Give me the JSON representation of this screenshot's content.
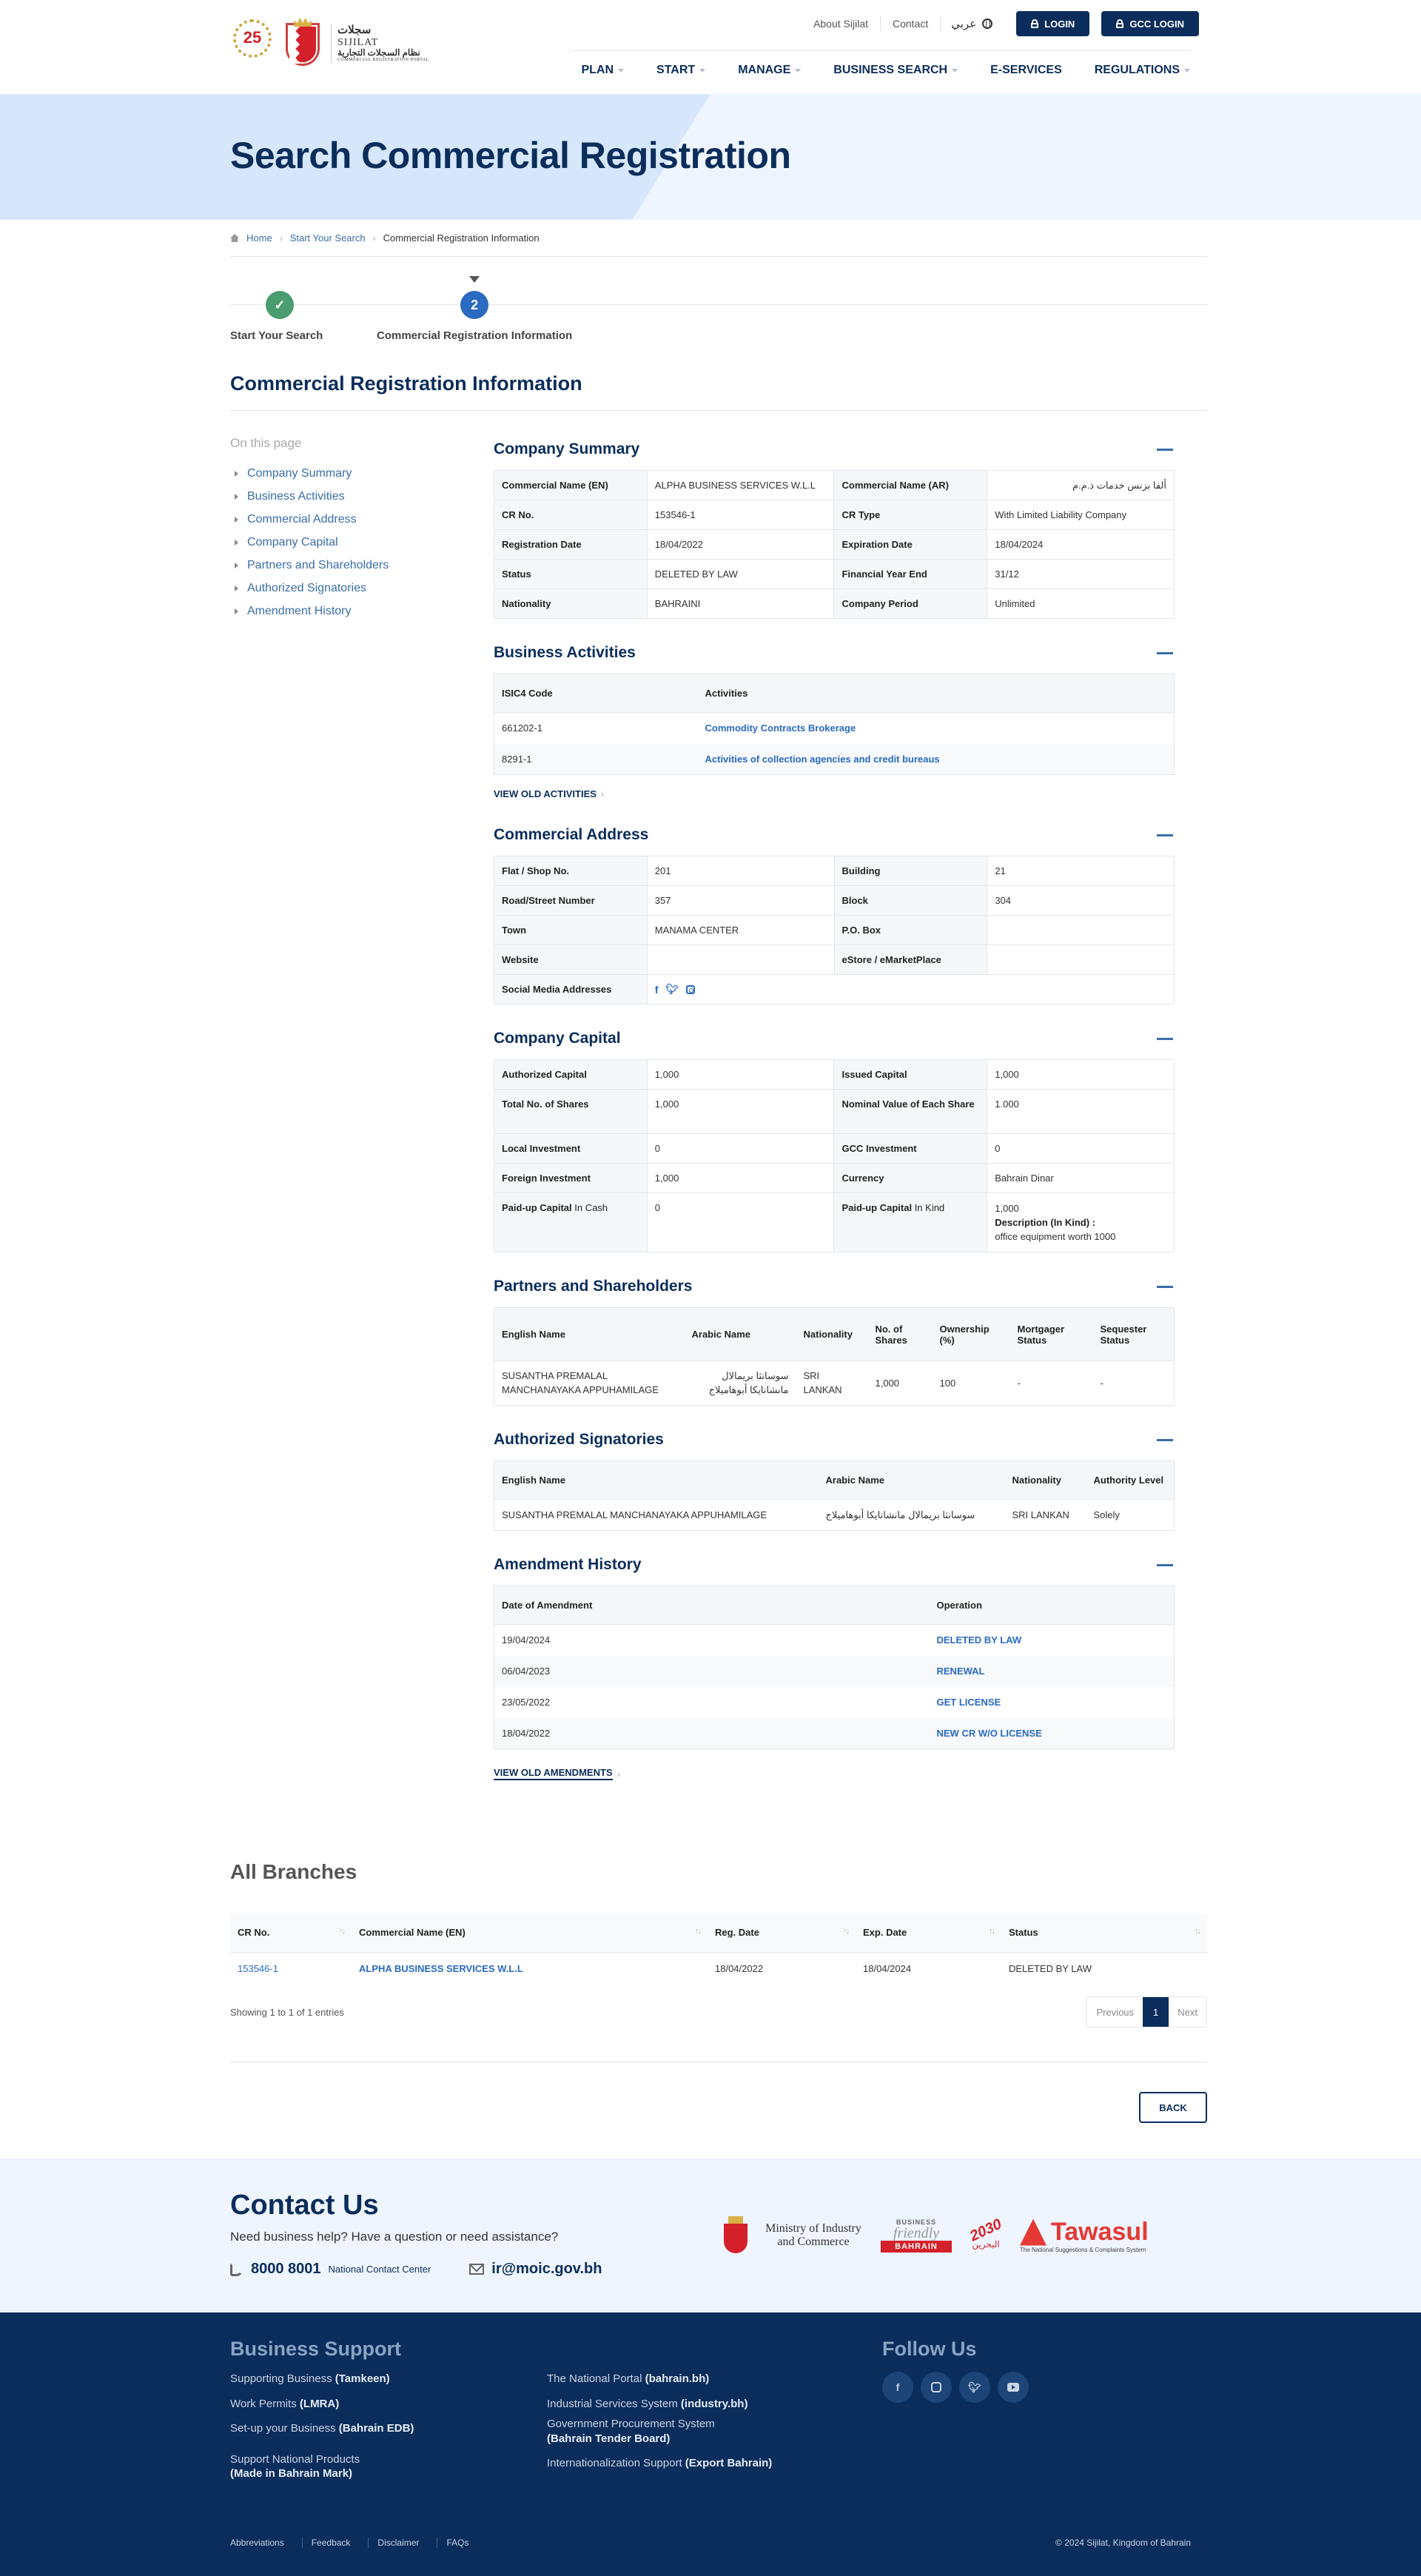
{
  "header": {
    "logo": {
      "badge": "25",
      "arabic": "سجلات",
      "english": "SIJILAT",
      "arabic_sub": "نظام السجلات التجارية",
      "portal": "COMMERCIAL REGISTRATION PORTAL"
    },
    "top_links": [
      "About Sijilat",
      "Contact"
    ],
    "language": "عربي",
    "login_label": "LOGIN",
    "gcc_login_label": "GCC LOGIN",
    "nav": [
      {
        "label": "PLAN",
        "dropdown": true
      },
      {
        "label": "START",
        "dropdown": true
      },
      {
        "label": "MANAGE",
        "dropdown": true
      },
      {
        "label": "BUSINESS SEARCH",
        "dropdown": true
      },
      {
        "label": "E-SERVICES",
        "dropdown": false
      },
      {
        "label": "REGULATIONS",
        "dropdown": true
      }
    ]
  },
  "hero": {
    "title": "Search Commercial Registration"
  },
  "breadcrumb": {
    "home": "Home",
    "step": "Start Your Search",
    "current": "Commercial Registration Information"
  },
  "stepper": {
    "steps": [
      {
        "label": "Start Your Search",
        "marker": "✓",
        "state": "done"
      },
      {
        "label": "Commercial Registration Information",
        "marker": "2",
        "state": "current"
      }
    ]
  },
  "page_title": "Commercial Registration Information",
  "sidenav": {
    "heading": "On this page",
    "items": [
      "Company Summary",
      "Business Activities",
      "Commercial Address",
      "Company Capital",
      "Partners and Shareholders",
      "Authorized Signatories",
      "Amendment History"
    ]
  },
  "summary": {
    "title": "Company Summary",
    "rows": [
      {
        "k1": "Commercial Name (EN)",
        "v1": "ALPHA BUSINESS SERVICES W.L.L",
        "k2": "Commercial Name (AR)",
        "v2": "ألفا بزنس خدمات ذ.م.م"
      },
      {
        "k1": "CR No.",
        "v1": "153546-1",
        "k2": "CR Type",
        "v2": "With Limited Liability Company"
      },
      {
        "k1": "Registration Date",
        "v1": "18/04/2022",
        "k2": "Expiration Date",
        "v2": "18/04/2024"
      },
      {
        "k1": "Status",
        "v1": "DELETED BY LAW",
        "k2": "Financial Year End",
        "v2": "31/12"
      },
      {
        "k1": "Nationality",
        "v1": "BAHRAINI",
        "k2": "Company Period",
        "v2": "Unlimited"
      }
    ],
    "status_color": "#d4202a"
  },
  "activities": {
    "title": "Business Activities",
    "headers": [
      "ISIC4 Code",
      "Activities"
    ],
    "rows": [
      {
        "code": "661202-1",
        "activity": "Commodity Contracts Brokerage"
      },
      {
        "code": "8291-1",
        "activity": "Activities of collection agencies and credit bureaus"
      }
    ],
    "more": "VIEW OLD ACTIVITIES"
  },
  "address": {
    "title": "Commercial Address",
    "rows": [
      {
        "k1": "Flat / Shop No.",
        "v1": "201",
        "k2": "Building",
        "v2": "21"
      },
      {
        "k1": "Road/Street Number",
        "v1": "357",
        "k2": "Block",
        "v2": "304"
      },
      {
        "k1": "Town",
        "v1": "MANAMA CENTER",
        "k2": "P.O. Box",
        "v2": ""
      },
      {
        "k1": "Website",
        "v1": "",
        "k2": "eStore / eMarketPlace",
        "v2": ""
      }
    ],
    "social_label": "Social Media Addresses",
    "social_icons": [
      "facebook-icon",
      "twitter-icon",
      "instagram-icon"
    ]
  },
  "capital": {
    "title": "Company Capital",
    "rows": [
      {
        "k1": "Authorized Capital",
        "v1": "1,000",
        "k2": "Issued Capital",
        "v2": "1,000"
      },
      {
        "k1": "Total No. of Shares",
        "v1": "1,000",
        "k2": "Nominal Value of Each Share",
        "v2": "1.000"
      },
      {
        "k1": "Local Investment",
        "v1": "0",
        "k2": "GCC Investment",
        "v2": "0"
      },
      {
        "k1": "Foreign Investment",
        "v1": "1,000",
        "k2": "Currency",
        "v2": "Bahrain Dinar"
      }
    ],
    "paid_cash_label_bold": "Paid-up Capital",
    "paid_cash_label_rest": " In Cash",
    "paid_cash_value": "0",
    "paid_kind_label_bold": "Paid-up Capital",
    "paid_kind_label_rest": " In Kind",
    "paid_kind_value": "1,000",
    "kind_desc_label": "Description (In Kind) :",
    "kind_desc_value": "office equipment worth 1000"
  },
  "partners": {
    "title": "Partners and Shareholders",
    "headers": [
      "English Name",
      "Arabic Name",
      "Nationality",
      "No. of Shares",
      "Ownership (%)",
      "Mortgager Status",
      "Sequester Status"
    ],
    "rows": [
      {
        "en": "SUSANTHA PREMALAL MANCHANAYAKA APPUHAMILAGE",
        "ar": "سوسانثا بريمالال مانشانايكا أبوهاميلاج",
        "nat": "SRI LANKAN",
        "shares": "1,000",
        "own": "100",
        "mort": "-",
        "seq": "-"
      }
    ]
  },
  "signatories": {
    "title": "Authorized Signatories",
    "headers": [
      "English Name",
      "Arabic Name",
      "Nationality",
      "Authority Level"
    ],
    "rows": [
      {
        "en": "SUSANTHA PREMALAL MANCHANAYAKA APPUHAMILAGE",
        "ar": "سوسانثا بريمالال مانشانايكا أبوهاميلاج",
        "nat": "SRI LANKAN",
        "level": "Solely"
      }
    ]
  },
  "amendments": {
    "title": "Amendment History",
    "headers": [
      "Date of Amendment",
      "Operation"
    ],
    "rows": [
      {
        "date": "19/04/2024",
        "op": "DELETED BY LAW"
      },
      {
        "date": "06/04/2023",
        "op": "RENEWAL"
      },
      {
        "date": "23/05/2022",
        "op": "GET LICENSE"
      },
      {
        "date": "18/04/2022",
        "op": "NEW CR W/O LICENSE"
      }
    ],
    "more": "VIEW OLD AMENDMENTS"
  },
  "branches": {
    "title": "All Branches",
    "headers": [
      "CR No.",
      "Commercial Name (EN)",
      "Reg. Date",
      "Exp. Date",
      "Status"
    ],
    "rows": [
      {
        "cr": "153546-1",
        "name": "ALPHA BUSINESS SERVICES W.L.L",
        "reg": "18/04/2022",
        "exp": "18/04/2024",
        "status": "DELETED BY LAW"
      }
    ],
    "info": "Showing 1 to 1 of 1 entries",
    "pager": {
      "prev": "Previous",
      "page": "1",
      "next": "Next"
    }
  },
  "back_label": "BACK",
  "contact": {
    "title": "Contact Us",
    "subtitle": "Need business help? Have a question or need assistance?",
    "phone": "8000 8001",
    "phone_label": "National Contact Center",
    "email": "ir@moic.gov.bh",
    "partners": {
      "moic": "Ministry of Industry and Commerce",
      "bf_top": "BUSINESS",
      "bf_mid": "friendly",
      "bf_bottom": "BAHRAIN",
      "vision_year": "2030",
      "vision_ar": "البحرين",
      "tawasul": "Tawasul",
      "tawasul_tag": "The National Suggestions & Complaints System"
    }
  },
  "footer": {
    "support_title": "Business Support",
    "col1": [
      {
        "text": "Supporting Business ",
        "bold": "(Tamkeen)"
      },
      {
        "text": "Work Permits ",
        "bold": "(LMRA)"
      },
      {
        "text": "Set-up your Business ",
        "bold": "(Bahrain EDB)"
      },
      {
        "text": "Support National Products",
        "bold": "(Made in Bahrain Mark)"
      }
    ],
    "col2": [
      {
        "text": "The National Portal ",
        "bold": "(bahrain.bh)"
      },
      {
        "text": "Industrial Services System ",
        "bold": "(industry.bh)"
      },
      {
        "text": "Government Procurement System",
        "bold": "(Bahrain Tender Board)"
      },
      {
        "text": "Internationalization Support ",
        "bold": "(Export Bahrain)"
      }
    ],
    "follow_title": "Follow Us",
    "bottom_links": [
      "Abbreviations",
      "Feedback",
      "Disclaimer",
      "FAQs"
    ],
    "copyright": "© 2024 Sijilat, Kingdom of Bahrain"
  }
}
